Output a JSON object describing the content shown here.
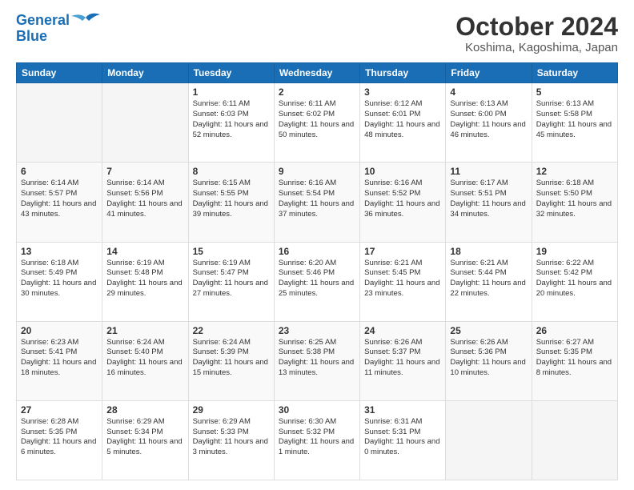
{
  "logo": {
    "line1": "General",
    "line2": "Blue"
  },
  "title": "October 2024",
  "location": "Koshima, Kagoshima, Japan",
  "days_of_week": [
    "Sunday",
    "Monday",
    "Tuesday",
    "Wednesday",
    "Thursday",
    "Friday",
    "Saturday"
  ],
  "weeks": [
    [
      {
        "day": "",
        "info": ""
      },
      {
        "day": "",
        "info": ""
      },
      {
        "day": "1",
        "info": "Sunrise: 6:11 AM\nSunset: 6:03 PM\nDaylight: 11 hours and 52 minutes."
      },
      {
        "day": "2",
        "info": "Sunrise: 6:11 AM\nSunset: 6:02 PM\nDaylight: 11 hours and 50 minutes."
      },
      {
        "day": "3",
        "info": "Sunrise: 6:12 AM\nSunset: 6:01 PM\nDaylight: 11 hours and 48 minutes."
      },
      {
        "day": "4",
        "info": "Sunrise: 6:13 AM\nSunset: 6:00 PM\nDaylight: 11 hours and 46 minutes."
      },
      {
        "day": "5",
        "info": "Sunrise: 6:13 AM\nSunset: 5:58 PM\nDaylight: 11 hours and 45 minutes."
      }
    ],
    [
      {
        "day": "6",
        "info": "Sunrise: 6:14 AM\nSunset: 5:57 PM\nDaylight: 11 hours and 43 minutes."
      },
      {
        "day": "7",
        "info": "Sunrise: 6:14 AM\nSunset: 5:56 PM\nDaylight: 11 hours and 41 minutes."
      },
      {
        "day": "8",
        "info": "Sunrise: 6:15 AM\nSunset: 5:55 PM\nDaylight: 11 hours and 39 minutes."
      },
      {
        "day": "9",
        "info": "Sunrise: 6:16 AM\nSunset: 5:54 PM\nDaylight: 11 hours and 37 minutes."
      },
      {
        "day": "10",
        "info": "Sunrise: 6:16 AM\nSunset: 5:52 PM\nDaylight: 11 hours and 36 minutes."
      },
      {
        "day": "11",
        "info": "Sunrise: 6:17 AM\nSunset: 5:51 PM\nDaylight: 11 hours and 34 minutes."
      },
      {
        "day": "12",
        "info": "Sunrise: 6:18 AM\nSunset: 5:50 PM\nDaylight: 11 hours and 32 minutes."
      }
    ],
    [
      {
        "day": "13",
        "info": "Sunrise: 6:18 AM\nSunset: 5:49 PM\nDaylight: 11 hours and 30 minutes."
      },
      {
        "day": "14",
        "info": "Sunrise: 6:19 AM\nSunset: 5:48 PM\nDaylight: 11 hours and 29 minutes."
      },
      {
        "day": "15",
        "info": "Sunrise: 6:19 AM\nSunset: 5:47 PM\nDaylight: 11 hours and 27 minutes."
      },
      {
        "day": "16",
        "info": "Sunrise: 6:20 AM\nSunset: 5:46 PM\nDaylight: 11 hours and 25 minutes."
      },
      {
        "day": "17",
        "info": "Sunrise: 6:21 AM\nSunset: 5:45 PM\nDaylight: 11 hours and 23 minutes."
      },
      {
        "day": "18",
        "info": "Sunrise: 6:21 AM\nSunset: 5:44 PM\nDaylight: 11 hours and 22 minutes."
      },
      {
        "day": "19",
        "info": "Sunrise: 6:22 AM\nSunset: 5:42 PM\nDaylight: 11 hours and 20 minutes."
      }
    ],
    [
      {
        "day": "20",
        "info": "Sunrise: 6:23 AM\nSunset: 5:41 PM\nDaylight: 11 hours and 18 minutes."
      },
      {
        "day": "21",
        "info": "Sunrise: 6:24 AM\nSunset: 5:40 PM\nDaylight: 11 hours and 16 minutes."
      },
      {
        "day": "22",
        "info": "Sunrise: 6:24 AM\nSunset: 5:39 PM\nDaylight: 11 hours and 15 minutes."
      },
      {
        "day": "23",
        "info": "Sunrise: 6:25 AM\nSunset: 5:38 PM\nDaylight: 11 hours and 13 minutes."
      },
      {
        "day": "24",
        "info": "Sunrise: 6:26 AM\nSunset: 5:37 PM\nDaylight: 11 hours and 11 minutes."
      },
      {
        "day": "25",
        "info": "Sunrise: 6:26 AM\nSunset: 5:36 PM\nDaylight: 11 hours and 10 minutes."
      },
      {
        "day": "26",
        "info": "Sunrise: 6:27 AM\nSunset: 5:35 PM\nDaylight: 11 hours and 8 minutes."
      }
    ],
    [
      {
        "day": "27",
        "info": "Sunrise: 6:28 AM\nSunset: 5:35 PM\nDaylight: 11 hours and 6 minutes."
      },
      {
        "day": "28",
        "info": "Sunrise: 6:29 AM\nSunset: 5:34 PM\nDaylight: 11 hours and 5 minutes."
      },
      {
        "day": "29",
        "info": "Sunrise: 6:29 AM\nSunset: 5:33 PM\nDaylight: 11 hours and 3 minutes."
      },
      {
        "day": "30",
        "info": "Sunrise: 6:30 AM\nSunset: 5:32 PM\nDaylight: 11 hours and 1 minute."
      },
      {
        "day": "31",
        "info": "Sunrise: 6:31 AM\nSunset: 5:31 PM\nDaylight: 11 hours and 0 minutes."
      },
      {
        "day": "",
        "info": ""
      },
      {
        "day": "",
        "info": ""
      }
    ]
  ]
}
